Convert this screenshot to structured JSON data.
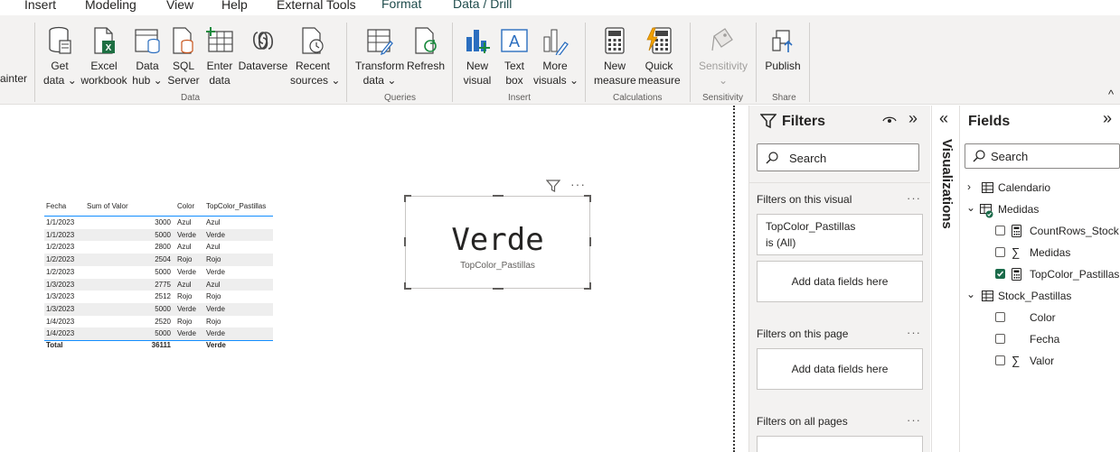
{
  "menu_tabs": [
    "Insert",
    "Modeling",
    "View",
    "Help",
    "External Tools",
    "Format",
    "Data / Drill"
  ],
  "ribbon": {
    "left_partial": "ainter",
    "buttons": {
      "get_data": [
        "Get",
        "data ⌄"
      ],
      "excel": [
        "Excel",
        "workbook"
      ],
      "data_hub": [
        "Data",
        "hub ⌄"
      ],
      "sql": [
        "SQL",
        "Server"
      ],
      "enter_data": [
        "Enter",
        "data"
      ],
      "dataverse": [
        "Dataverse"
      ],
      "recent": [
        "Recent",
        "sources ⌄"
      ],
      "transform": [
        "Transform",
        "data ⌄"
      ],
      "refresh": [
        "Refresh"
      ],
      "new_visual": [
        "New",
        "visual"
      ],
      "text_box": [
        "Text",
        "box"
      ],
      "more_visuals": [
        "More",
        "visuals ⌄"
      ],
      "new_measure": [
        "New",
        "measure"
      ],
      "quick_measure": [
        "Quick",
        "measure"
      ],
      "sensitivity": [
        "Sensitivity",
        "⌄"
      ],
      "publish": [
        "Publish"
      ]
    },
    "groups": {
      "data": "Data",
      "queries": "Queries",
      "insert": "Insert",
      "calculations": "Calculations",
      "sensitivity": "Sensitivity",
      "share": "Share"
    },
    "collapse_glyph": "^"
  },
  "table": {
    "headers": [
      "Fecha",
      "Sum of Valor",
      "Color",
      "TopColor_Pastillas"
    ],
    "rows": [
      [
        "1/1/2023",
        "3000",
        "Azul",
        "Azul"
      ],
      [
        "1/1/2023",
        "5000",
        "Verde",
        "Verde"
      ],
      [
        "1/2/2023",
        "2800",
        "Azul",
        "Azul"
      ],
      [
        "1/2/2023",
        "2504",
        "Rojo",
        "Rojo"
      ],
      [
        "1/2/2023",
        "5000",
        "Verde",
        "Verde"
      ],
      [
        "1/3/2023",
        "2775",
        "Azul",
        "Azul"
      ],
      [
        "1/3/2023",
        "2512",
        "Rojo",
        "Rojo"
      ],
      [
        "1/3/2023",
        "5000",
        "Verde",
        "Verde"
      ],
      [
        "1/4/2023",
        "2520",
        "Rojo",
        "Rojo"
      ],
      [
        "1/4/2023",
        "5000",
        "Verde",
        "Verde"
      ]
    ],
    "total": [
      "Total",
      "36111",
      "",
      "Verde"
    ]
  },
  "card": {
    "value": "Verde",
    "label": "TopColor_Pastillas",
    "more": "···"
  },
  "filters": {
    "title": "Filters",
    "search_placeholder": "Search",
    "on_visual": "Filters on this visual",
    "filter_card": {
      "field": "TopColor_Pastillas",
      "state": "is (All)"
    },
    "add_fields": "Add data fields here",
    "on_page": "Filters on this page",
    "on_all": "Filters on all pages",
    "dots": "···",
    "collapse": "»"
  },
  "visualizations": {
    "label": "Visualizations",
    "expand": "«"
  },
  "fields": {
    "title": "Fields",
    "collapse": "»",
    "search_placeholder": "Search",
    "tables": [
      {
        "name": "Calendario",
        "expanded": false
      },
      {
        "name": "Medidas",
        "expanded": true,
        "items": [
          {
            "name": "CountRows_Stock",
            "type": "calc",
            "checked": false
          },
          {
            "name": "Medidas",
            "type": "sigma",
            "checked": false
          },
          {
            "name": "TopColor_Pastillas",
            "type": "calc",
            "checked": true
          }
        ]
      },
      {
        "name": "Stock_Pastillas",
        "expanded": true,
        "items": [
          {
            "name": "Color",
            "type": "none",
            "checked": false
          },
          {
            "name": "Fecha",
            "type": "none",
            "checked": false
          },
          {
            "name": "Valor",
            "type": "sigma",
            "checked": false
          }
        ]
      }
    ]
  }
}
